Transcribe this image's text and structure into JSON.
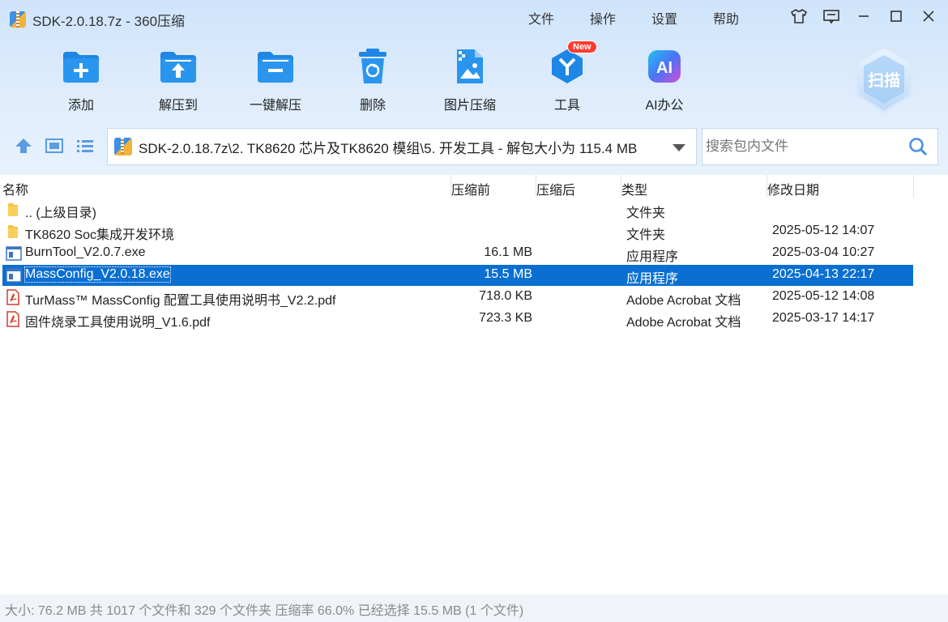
{
  "window": {
    "title": "SDK-2.0.18.7z - 360压缩"
  },
  "menu": [
    "文件",
    "操作",
    "设置",
    "帮助"
  ],
  "toolbar": [
    {
      "label": "添加",
      "icon": "add-folder-icon"
    },
    {
      "label": "解压到",
      "icon": "extract-to-icon"
    },
    {
      "label": "一键解压",
      "icon": "one-click-extract-icon"
    },
    {
      "label": "删除",
      "icon": "delete-icon"
    },
    {
      "label": "图片压缩",
      "icon": "image-compress-icon"
    },
    {
      "label": "工具",
      "icon": "tools-icon",
      "badge": "New"
    },
    {
      "label": "AI办公",
      "icon": "ai-office-icon",
      "glyph": "AI"
    }
  ],
  "scan": {
    "label": "扫描"
  },
  "address": {
    "path": "SDK-2.0.18.7z\\2. TK8620 芯片及TK8620 模组\\5. 开发工具 - 解包大小为 115.4 MB"
  },
  "search": {
    "placeholder": "搜索包内文件"
  },
  "columns": {
    "name": "名称",
    "packed": "压缩前",
    "unpacked": "压缩后",
    "type": "类型",
    "modified": "修改日期"
  },
  "files": [
    {
      "name": ".. (上级目录)",
      "size": "",
      "type": "文件夹",
      "date": "",
      "icon": "folder-icon"
    },
    {
      "name": "TK8620 Soc集成开发环境",
      "size": "",
      "type": "文件夹",
      "date": "2025-05-12 14:07",
      "icon": "folder-icon"
    },
    {
      "name": "BurnTool_V2.0.7.exe",
      "size": "16.1 MB",
      "type": "应用程序",
      "date": "2025-03-04 10:27",
      "icon": "exe-icon"
    },
    {
      "name": "MassConfig_V2.0.18.exe",
      "size": "15.5 MB",
      "type": "应用程序",
      "date": "2025-04-13 22:17",
      "icon": "exe-icon",
      "selected": true
    },
    {
      "name": "TurMass™ MassConfig 配置工具使用说明书_V2.2.pdf",
      "size": "718.0 KB",
      "type": "Adobe Acrobat 文档",
      "date": "2025-05-12 14:08",
      "icon": "pdf-icon"
    },
    {
      "name": "固件烧录工具使用说明_V1.6.pdf",
      "size": "723.3 KB",
      "type": "Adobe Acrobat 文档",
      "date": "2025-03-17 14:17",
      "icon": "pdf-icon"
    }
  ],
  "status": {
    "text": "大小: 76.2 MB 共 1017 个文件和 329 个文件夹 压缩率 66.0% 已经选择 15.5 MB (1 个文件)"
  },
  "colors": {
    "accent": "#1e7fe0",
    "selection": "#0a6fd1",
    "header_bg": "#d7e8fb"
  }
}
